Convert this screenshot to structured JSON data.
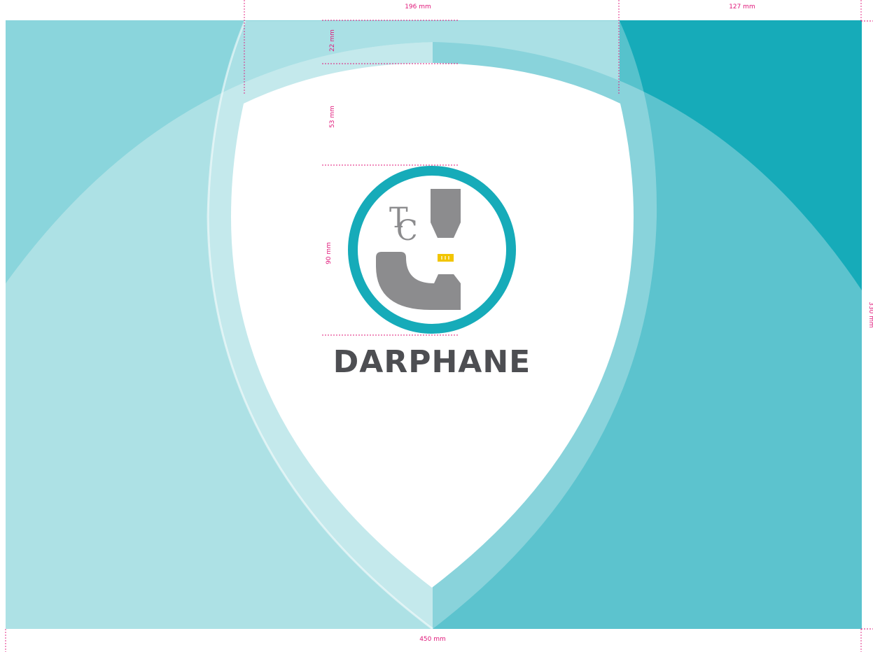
{
  "brand": {
    "name": "DARPHANE",
    "monogram_top": "T",
    "monogram_bottom": "C"
  },
  "dimensions": {
    "top_left_width": "196 mm",
    "top_right_width": "127 mm",
    "bottom_total_width": "450 mm",
    "vertical_22": "22 mm",
    "vertical_53": "53 mm",
    "vertical_90": "90 mm",
    "right_height": "330 mm"
  },
  "colors": {
    "dark_teal": "#16abb9",
    "mid_teal": "#5cc3ce",
    "light_teal": "#8ad5dc",
    "pale_teal": "#ade1e5",
    "logo_ring": "#16abb9",
    "logo_grey": "#8c8c8e",
    "accent_yellow": "#f2c500",
    "text_dark": "#4d4e52",
    "guide_magenta": "#e0187a"
  }
}
